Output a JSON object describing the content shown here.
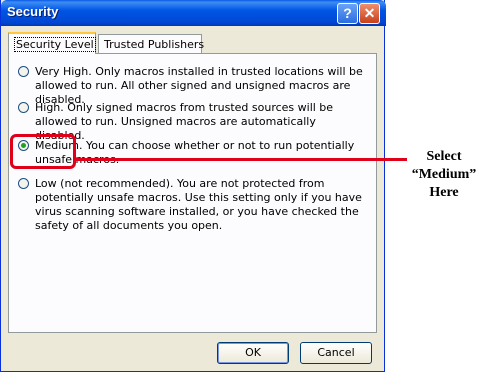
{
  "window": {
    "title": "Security",
    "help_glyph": "?",
    "close_glyph": "✕"
  },
  "tabs": [
    {
      "label": "Security Level",
      "active": true
    },
    {
      "label": "Trusted Publishers",
      "active": false
    }
  ],
  "options": [
    {
      "label": "Very High. Only macros installed in trusted locations will be allowed to run. All other signed and unsigned macros are disabled.",
      "checked": false
    },
    {
      "label": "High. Only signed macros from trusted sources will be allowed to run. Unsigned macros are automatically disabled.",
      "checked": false
    },
    {
      "label": "Medium. You can choose whether or not to run potentially unsafe macros.",
      "checked": true
    },
    {
      "label": "Low (not recommended). You are not protected from potentially unsafe macros. Use this setting only if you have virus scanning software installed, or you have checked the safety of all documents you open.",
      "checked": false
    }
  ],
  "buttons": {
    "ok_label": "OK",
    "cancel_label": "Cancel"
  },
  "annotation": {
    "line1": "Select",
    "line2": "“Medium”",
    "line3": "Here"
  },
  "colors": {
    "highlight": "#e0001a",
    "titlebar": "#0055e5",
    "dialog_bg": "#ece9d8"
  }
}
